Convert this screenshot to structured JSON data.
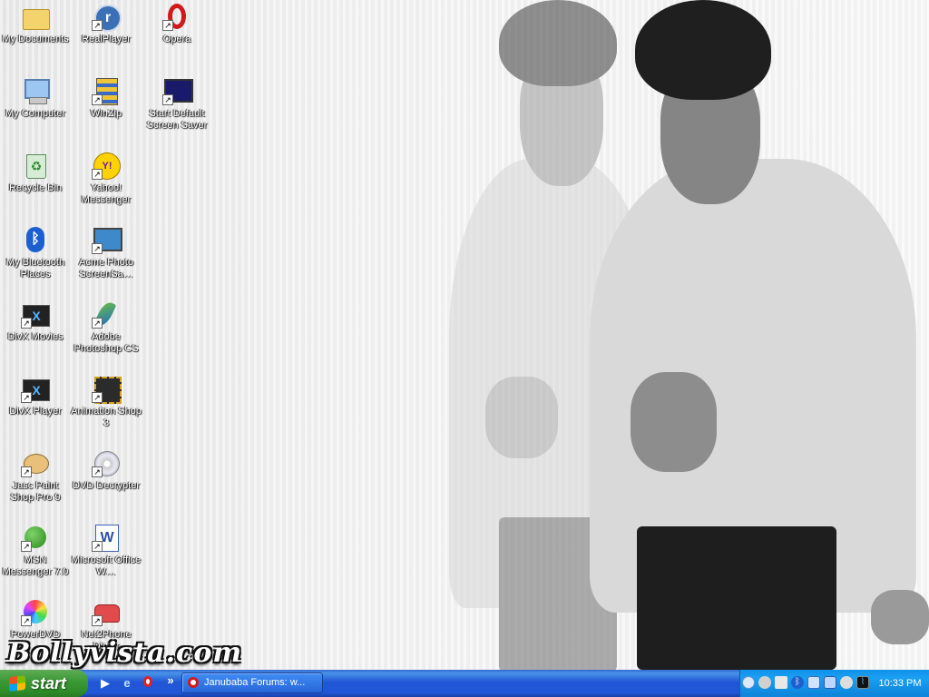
{
  "desktop": {
    "watermark": "Bollyvista.com",
    "icons": [
      {
        "label": "My Documents",
        "icon": "my-documents-icon"
      },
      {
        "label": "RealPlayer",
        "icon": "realplayer-icon"
      },
      {
        "label": "Opera",
        "icon": "opera-icon"
      },
      {
        "label": "My Computer",
        "icon": "my-computer-icon"
      },
      {
        "label": "WinZip",
        "icon": "winzip-icon"
      },
      {
        "label": "Start Default Screen Saver",
        "icon": "screen-saver-icon"
      },
      {
        "label": "Recycle Bin",
        "icon": "recycle-bin-icon"
      },
      {
        "label": "Yahoo! Messenger",
        "icon": "yahoo-messenger-icon"
      },
      {
        "label": "My Bluetooth Places",
        "icon": "bluetooth-icon"
      },
      {
        "label": "Acme Photo ScreenSa…",
        "icon": "acme-photo-icon"
      },
      {
        "label": "DivX Movies",
        "icon": "divx-movies-icon"
      },
      {
        "label": "Adobe Photoshop CS",
        "icon": "photoshop-icon"
      },
      {
        "label": "DivX Player",
        "icon": "divx-player-icon"
      },
      {
        "label": "Animation Shop 3",
        "icon": "animation-shop-icon"
      },
      {
        "label": "Jasc Paint Shop Pro 9",
        "icon": "paint-shop-pro-icon"
      },
      {
        "label": "DVD Decrypter",
        "icon": "dvd-decrypter-icon"
      },
      {
        "label": "MSN Messenger 7.0",
        "icon": "msn-messenger-icon"
      },
      {
        "label": "Microsoft Office W…",
        "icon": "ms-word-icon"
      },
      {
        "label": "PowerDVD",
        "icon": "powerdvd-icon"
      },
      {
        "label": "Net2Phone Dialer",
        "icon": "net2phone-icon"
      }
    ]
  },
  "taskbar": {
    "start_label": "start",
    "quick_launch": [
      "windows-media-player-icon",
      "internet-explorer-icon",
      "opera-icon"
    ],
    "chevron": "»",
    "task_button": "Janubaba Forums: w...",
    "tray_icons": [
      "show-hidden-icons-icon",
      "network-icon",
      "security-icon",
      "bluetooth-icon",
      "network-connections-icon",
      "monitor-icon",
      "volume-icon",
      "activity-icon"
    ],
    "clock": "10:33 PM"
  }
}
